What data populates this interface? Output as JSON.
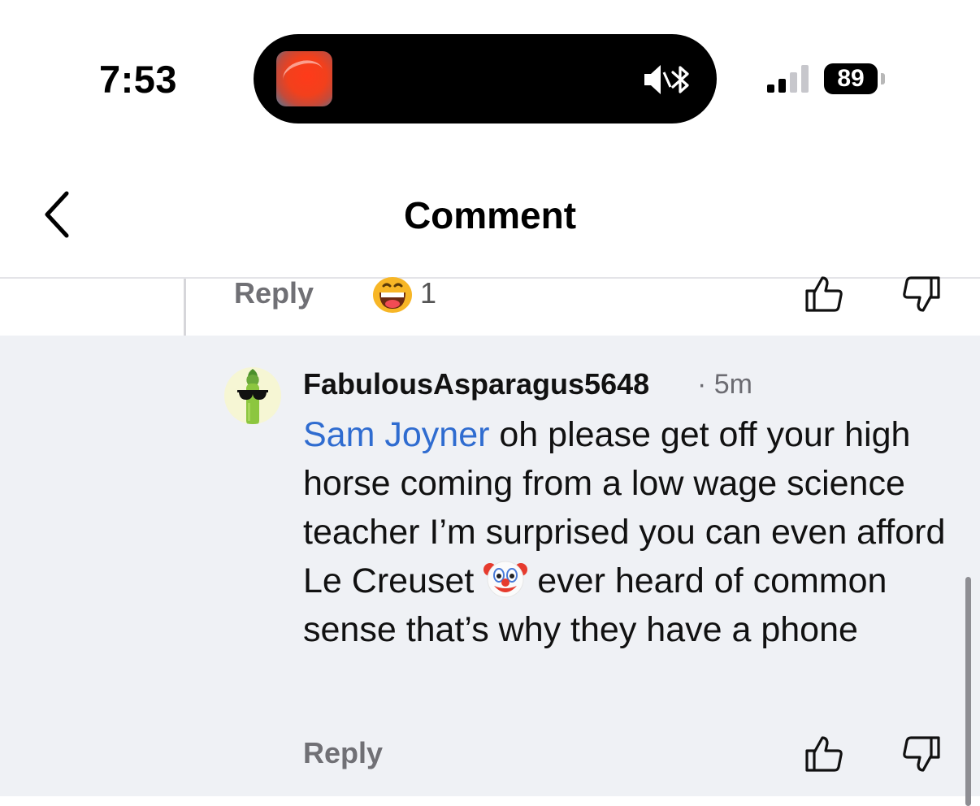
{
  "status_bar": {
    "time": "7:53",
    "battery": "89",
    "album_art_icon": "album-art-icon",
    "mute_icon": "mute-icon",
    "bluetooth_icon": "bluetooth-icon",
    "signal_icon": "signal-icon"
  },
  "nav": {
    "title": "Comment",
    "back_icon": "chevron-left-icon"
  },
  "previous_comment": {
    "reply_label": "Reply",
    "reaction_icon": "grinning-face-emoji",
    "reaction_count": "1",
    "upvote_icon": "thumbs-up-icon",
    "downvote_icon": "thumbs-down-icon"
  },
  "comment": {
    "username": "FabulousAsparagus5648",
    "time_ago": "· 5m",
    "mention": "Sam Joyner",
    "text_before_emoji": " oh please get off your high horse coming from a low wage science teacher I’m surprised you can even afford Le Creuset ",
    "emoji": "clown-face-emoji",
    "text_after_emoji": " ever heard of common sense that’s why they have a phone",
    "reply_label": "Reply",
    "avatar_icon": "asparagus-sunglasses-avatar"
  },
  "colors": {
    "mention_blue": "#2f6cd0",
    "comment_background": "#eff1f5",
    "muted_gray": "#707075"
  }
}
